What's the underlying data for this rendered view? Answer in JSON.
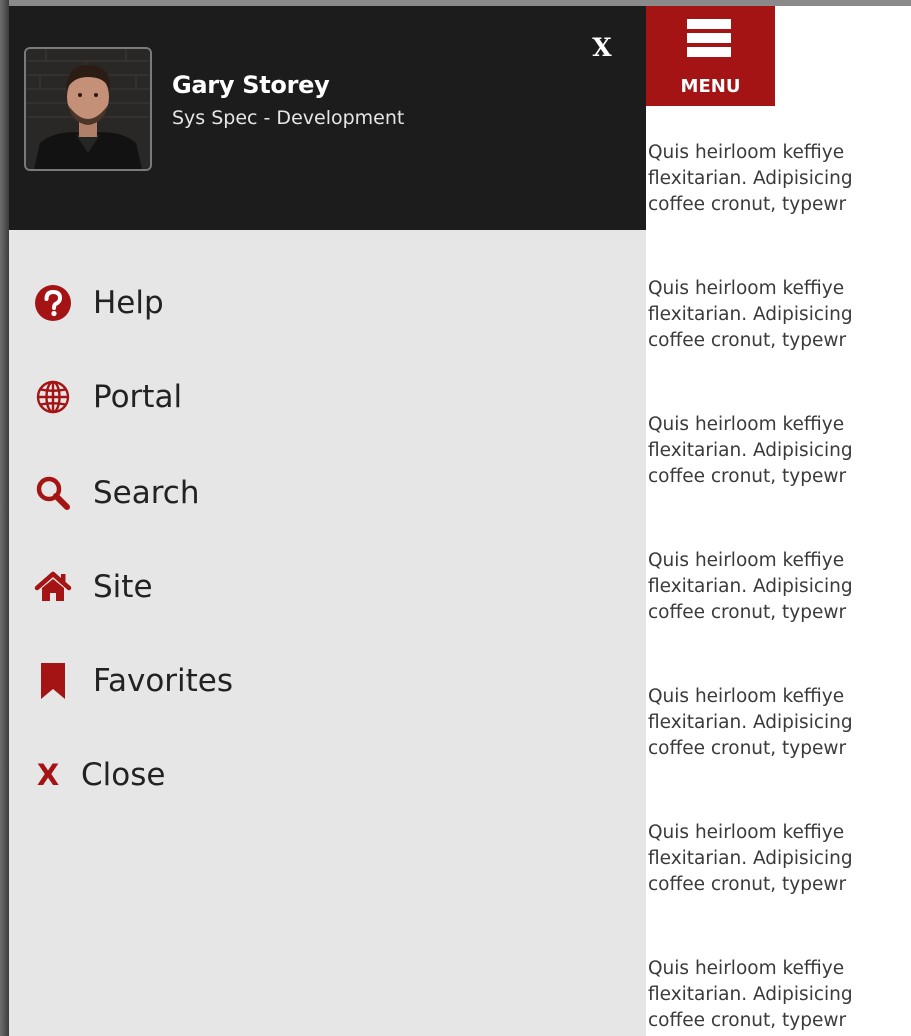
{
  "profile": {
    "name": "Gary Storey",
    "title": "Sys Spec - Development",
    "close_label": "X"
  },
  "nav": {
    "items": [
      {
        "label": "Help",
        "icon": "question-circle-icon"
      },
      {
        "label": "Portal",
        "icon": "globe-icon"
      },
      {
        "label": "Search",
        "icon": "search-icon"
      },
      {
        "label": "Site",
        "icon": "home-icon"
      },
      {
        "label": "Favorites",
        "icon": "bookmark-icon"
      },
      {
        "label": "Close",
        "icon": "close-icon",
        "glyph": "X"
      }
    ]
  },
  "header": {
    "menu_label": "MENU",
    "menu_icon": "hamburger-icon"
  },
  "content": {
    "line1": "Quis heirloom keffiye",
    "line2": "flexitarian. Adipisicing",
    "line3": "coffee cronut, typewr"
  },
  "colors": {
    "accent": "#a51414",
    "profile_bg": "#1c1c1c",
    "drawer_bg": "#e6e6e6"
  }
}
